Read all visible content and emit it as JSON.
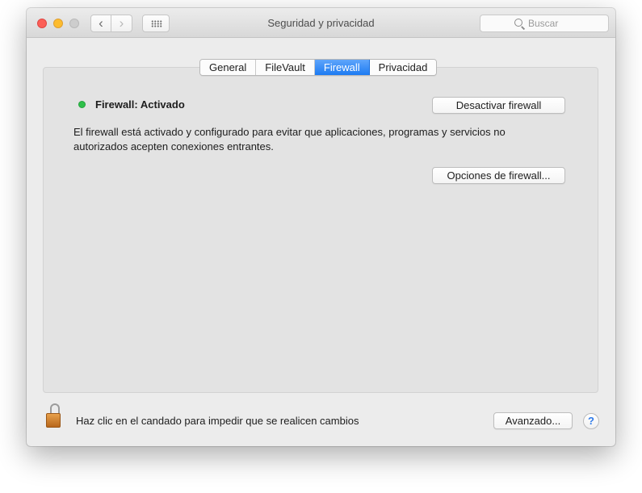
{
  "window": {
    "title": "Seguridad y privacidad"
  },
  "toolbar": {
    "back_icon": "‹",
    "forward_icon": "›",
    "search_placeholder": "Buscar"
  },
  "tabs": [
    {
      "label": "General",
      "active": false
    },
    {
      "label": "FileVault",
      "active": false
    },
    {
      "label": "Firewall",
      "active": true
    },
    {
      "label": "Privacidad",
      "active": false
    }
  ],
  "firewall": {
    "status_label": "Firewall: Activado",
    "status_color": "#2fc04a",
    "description": "El firewall está activado y configurado para evitar que aplicaciones, programas y servicios no autorizados acepten conexiones entrantes.",
    "deactivate_label": "Desactivar firewall",
    "options_label": "Opciones de firewall..."
  },
  "footer": {
    "lock_label": "Haz clic en el candado para impedir que se realicen cambios",
    "advanced_label": "Avanzado...",
    "help_label": "?"
  },
  "colors": {
    "accent": "#1d7bf2"
  }
}
